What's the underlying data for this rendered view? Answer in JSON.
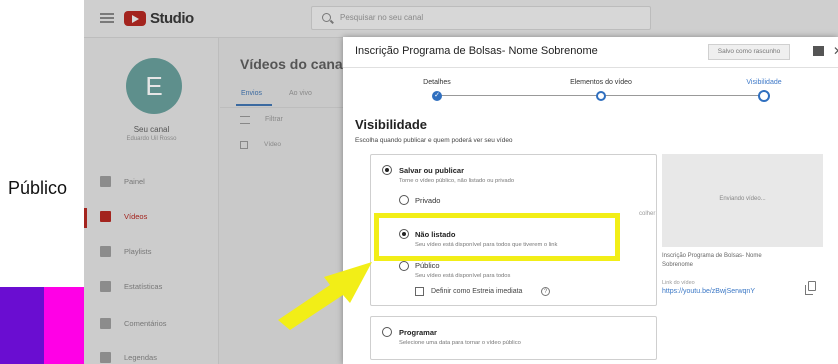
{
  "slide": {
    "label": "Público",
    "colors": {
      "purple": "#6a0dd1",
      "magenta": "#ff00e6",
      "highlight": "#f2ee17"
    }
  },
  "header": {
    "app_name": "Studio",
    "search_placeholder": "Pesquisar no seu canal"
  },
  "sidebar": {
    "avatar_letter": "E",
    "channel_name": "Seu canal",
    "channel_sub": "Eduardo Uil Rosso",
    "items": [
      {
        "label": "Painel",
        "icon": "dashboard-icon"
      },
      {
        "label": "Vídeos",
        "icon": "videos-icon"
      },
      {
        "label": "Playlists",
        "icon": "playlists-icon"
      },
      {
        "label": "Estatísticas",
        "icon": "analytics-icon"
      },
      {
        "label": "Comentários",
        "icon": "comments-icon"
      },
      {
        "label": "Legendas",
        "icon": "subtitles-icon"
      }
    ]
  },
  "content": {
    "title": "Vídeos do canal",
    "tabs": [
      "Envios",
      "Ao vivo"
    ],
    "filter_label": "Filtrar",
    "row_label": "Vídeo"
  },
  "dialog": {
    "title": "Inscrição Programa de Bolsas- Nome Sobrenome",
    "draft_button": "Salvo como rascunho",
    "steps": [
      "Detalhes",
      "Elementos do vídeo",
      "Visibilidade"
    ],
    "visibility_title": "Visibilidade",
    "visibility_subtitle": "Escolha quando publicar e quem poderá ver seu vídeo",
    "save_option": {
      "label": "Salvar ou publicar",
      "sub": "Torne o vídeo público, não listado ou privado"
    },
    "private": {
      "label": "Privado",
      "right_text": "colher"
    },
    "unlisted": {
      "label": "Não listado",
      "sub": "Seu vídeo está disponível para todos que tiverem o link"
    },
    "public": {
      "label": "Público",
      "sub": "Seu vídeo está disponível para todos"
    },
    "premiere_label": "Definir como Estreia imediata",
    "schedule": {
      "label": "Programar",
      "sub": "Selecione uma data para tornar o vídeo público"
    },
    "preview": {
      "sending": "Enviando vídeo...",
      "video_title": "Inscrição Programa de Bolsas- Nome Sobrenome",
      "link_label": "Link do vídeo",
      "link_url": "https://youtu.be/zBwjSerwqnY"
    }
  }
}
